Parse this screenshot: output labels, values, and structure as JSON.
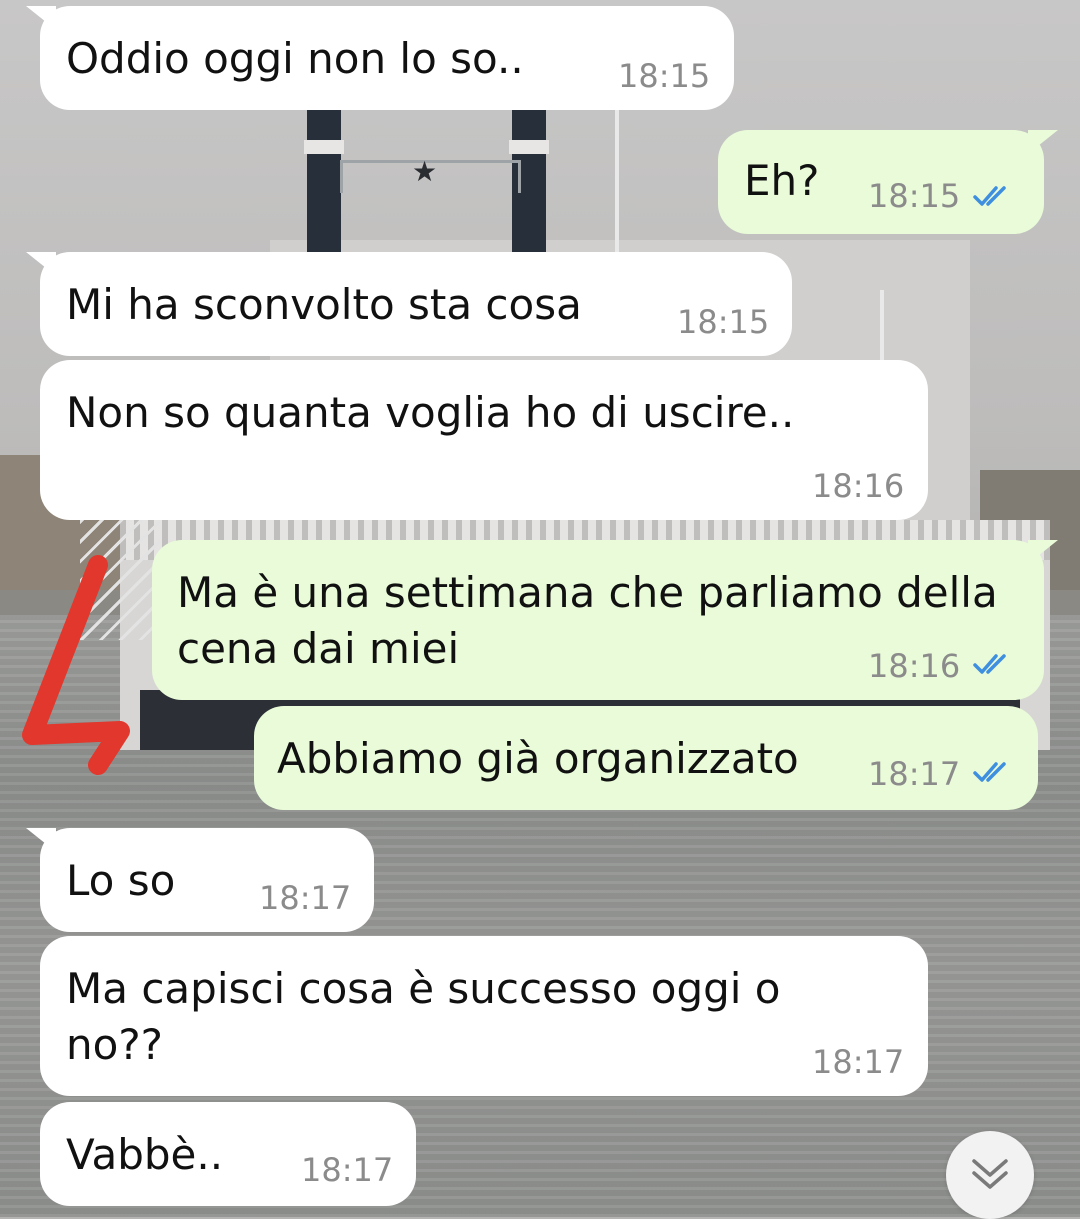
{
  "messages": [
    {
      "side": "in",
      "text_lines": [
        "Oddio oggi non lo so.."
      ],
      "time": "18:15"
    },
    {
      "side": "out",
      "text_lines": [
        "Eh?"
      ],
      "time": "18:15",
      "status": "read"
    },
    {
      "side": "in",
      "text_lines": [
        "Mi ha sconvolto sta cosa"
      ],
      "time": "18:15"
    },
    {
      "side": "in",
      "text_lines": [
        "Non so quanta voglia ho di uscire.."
      ],
      "time": "18:16"
    },
    {
      "side": "out",
      "text_lines": [
        "Ma è una settimana che parliamo della",
        "cena dai miei"
      ],
      "time": "18:16",
      "status": "read"
    },
    {
      "side": "out",
      "text_lines": [
        "Abbiamo già organizzato"
      ],
      "time": "18:17",
      "status": "read"
    },
    {
      "side": "in",
      "text_lines": [
        "Lo so"
      ],
      "time": "18:17"
    },
    {
      "side": "in",
      "text_lines": [
        "Ma capisci cosa è successo oggi o",
        "no??"
      ],
      "time": "18:17"
    },
    {
      "side": "in",
      "text_lines": [
        "Vabbè.."
      ],
      "time": "18:17"
    }
  ],
  "colors": {
    "incoming_bubble": "#ffffff",
    "outgoing_bubble": "#e9fbd8",
    "read_ticks": "#3f8fe0",
    "timestamp": "#8b8b8b",
    "annotation_mark": "#e2372c"
  },
  "icons": {
    "read_receipt": "double-check-icon",
    "scroll_down": "chevron-double-down-icon"
  }
}
